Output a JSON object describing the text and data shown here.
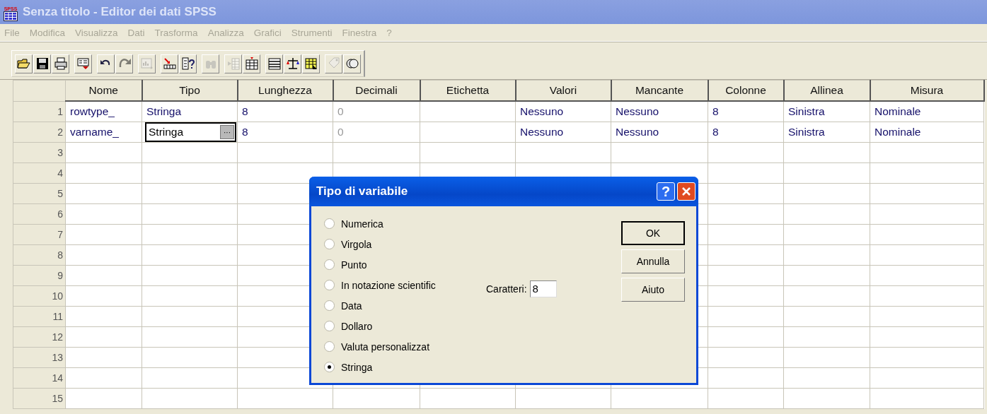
{
  "window": {
    "title": "Senza titolo - Editor dei dati SPSS",
    "icon_text": "SPSS",
    "active": false
  },
  "menu": [
    {
      "label": "File"
    },
    {
      "label": "Modifica"
    },
    {
      "label": "Visualizza"
    },
    {
      "label": "Dati"
    },
    {
      "label": "Trasforma"
    },
    {
      "label": "Analizza"
    },
    {
      "label": "Grafici"
    },
    {
      "label": "Strumenti"
    },
    {
      "label": "Finestra"
    },
    {
      "label": "?"
    }
  ],
  "toolbar": {
    "groups": [
      {
        "buttons": [
          {
            "kind": "open",
            "disabled": false
          },
          {
            "kind": "save",
            "disabled": false
          },
          {
            "kind": "print",
            "disabled": false
          }
        ]
      },
      {
        "buttons": [
          {
            "kind": "recall",
            "disabled": false
          }
        ]
      },
      {
        "buttons": [
          {
            "kind": "undo",
            "disabled": false
          },
          {
            "kind": "redo",
            "disabled": true
          }
        ]
      },
      {
        "buttons": [
          {
            "kind": "chart",
            "disabled": true
          }
        ]
      },
      {
        "buttons": [
          {
            "kind": "goto",
            "disabled": false
          },
          {
            "kind": "variables",
            "disabled": false
          }
        ]
      },
      {
        "buttons": [
          {
            "kind": "find",
            "disabled": true
          }
        ]
      },
      {
        "buttons": [
          {
            "kind": "insertcase",
            "disabled": true
          },
          {
            "kind": "insertvar",
            "disabled": false
          }
        ]
      },
      {
        "buttons": [
          {
            "kind": "split",
            "disabled": false
          },
          {
            "kind": "weight",
            "disabled": false
          },
          {
            "kind": "select",
            "disabled": false
          }
        ]
      },
      {
        "buttons": [
          {
            "kind": "labels",
            "disabled": true
          },
          {
            "kind": "sets",
            "disabled": false
          }
        ]
      }
    ]
  },
  "table": {
    "columns": [
      "Nome",
      "Tipo",
      "Lunghezza",
      "Decimali",
      "Etichetta",
      "Valori",
      "Mancante",
      "Colonne",
      "Allinea",
      "Misura"
    ],
    "rows": [
      {
        "number": "1",
        "cells": [
          "rowtype_",
          "Stringa",
          "8",
          {
            "text": "0",
            "disabled": true
          },
          null,
          "Nessuno",
          "Nessuno",
          "8",
          "Sinistra",
          "Nominale"
        ]
      },
      {
        "number": "2",
        "cells": [
          "varname_",
          {
            "text": "Stringa",
            "editing": true,
            "button": "···"
          },
          "8",
          {
            "text": "0",
            "disabled": true
          },
          null,
          "Nessuno",
          "Nessuno",
          "8",
          "Sinistra",
          "Nominale"
        ]
      },
      {
        "number": "3"
      },
      {
        "number": "4"
      },
      {
        "number": "5"
      },
      {
        "number": "6"
      },
      {
        "number": "7"
      },
      {
        "number": "8"
      },
      {
        "number": "9"
      },
      {
        "number": "10"
      },
      {
        "number": "11"
      },
      {
        "number": "12"
      },
      {
        "number": "13"
      },
      {
        "number": "14"
      },
      {
        "number": "15"
      }
    ]
  },
  "dialog": {
    "title": "Tipo di variabile",
    "help": "?",
    "options": [
      {
        "label": "Numerica",
        "selected": false
      },
      {
        "label": "Virgola",
        "selected": false
      },
      {
        "label": "Punto",
        "selected": false
      },
      {
        "label": "In notazione scientific",
        "selected": false
      },
      {
        "label": "Data",
        "selected": false
      },
      {
        "label": "Dollaro",
        "selected": false
      },
      {
        "label": "Valuta personalizzat",
        "selected": false
      },
      {
        "label": "Stringa",
        "selected": true
      }
    ],
    "field": {
      "label": "Caratteri:",
      "value": "8"
    },
    "buttons": [
      {
        "label": "OK",
        "default": true
      },
      {
        "label": "Annulla",
        "default": false
      },
      {
        "label": "Aiuto",
        "default": false
      }
    ]
  }
}
